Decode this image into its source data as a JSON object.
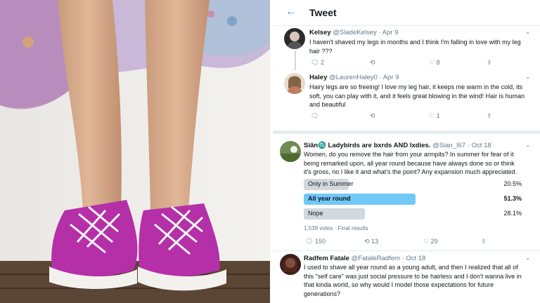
{
  "header": {
    "back_icon": "back-arrow-icon",
    "title": "Tweet"
  },
  "tweets": [
    {
      "name": "Kelsey",
      "handle": "@SladeKelsey",
      "date": "Apr 9",
      "text": "I haven't shaved my legs in months and I think I'm falling in love with my leg hair ???",
      "replies": "2",
      "retweets": "",
      "likes": "8"
    },
    {
      "name": "Haley",
      "handle": "@LaurenHaley0",
      "date": "Apr 9",
      "text": "Hairy legs are so freeing! I love my leg hair, it keeps me warm in the cold, its soft, you can play with it, and it feels great blowing in the wind! Hair is human and beautiful",
      "replies": "",
      "retweets": "",
      "likes": "1"
    },
    {
      "name": "Siân♏ Ladybirds are bxrds AND lxdies.",
      "handle": "@Sian_I67",
      "date": "Oct 18",
      "text": "Women, do you remove the hair from your armpits? In summer for fear of it being remarked upon, all year round because have always done so or think it's gross, no I like it and what's the point? Any expansion much appreciated.",
      "replies": "150",
      "retweets": "13",
      "likes": "29"
    },
    {
      "name": "Radfem Fatale",
      "handle": "@FataleRadfem",
      "date": "Oct 18",
      "text": "I used to shave all year round as a young adult, and then I realized that all of this \"self care\" was just social pressure to be hairless and I don't wanna live in that kinda world, so why would I model those expectations for future generations?"
    }
  ],
  "poll": {
    "options": [
      {
        "label": "Only in Summer",
        "percent": "20.5%",
        "fraction": 0.205,
        "winner": false
      },
      {
        "label": "All year round",
        "percent": "51.3%",
        "fraction": 0.513,
        "winner": true
      },
      {
        "label": "Nope",
        "percent": "28.1%",
        "fraction": 0.281,
        "winner": false
      }
    ],
    "meta": "1,539 votes · Final results"
  },
  "colors": {
    "accent": "#1da1f2",
    "poll_winner": "#71c9f8",
    "poll_other": "#cfd9de",
    "shoe": "#b52fa8"
  }
}
